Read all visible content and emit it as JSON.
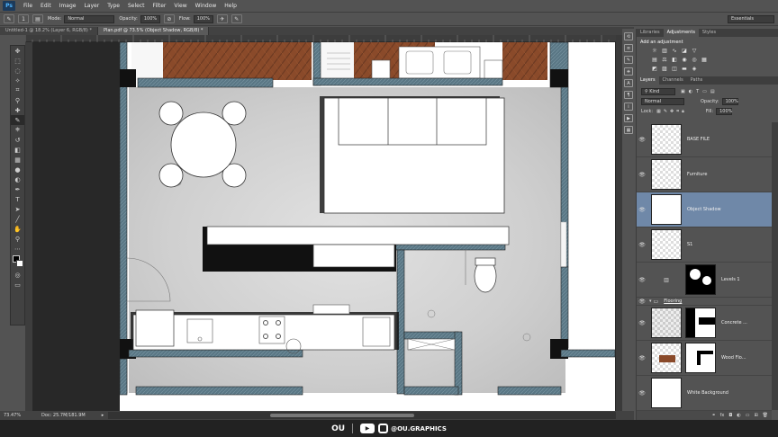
{
  "menubar": {
    "logo": "Ps",
    "items": [
      "File",
      "Edit",
      "Image",
      "Layer",
      "Type",
      "Select",
      "Filter",
      "View",
      "Window",
      "Help"
    ]
  },
  "options": {
    "mode_label": "Mode:",
    "mode_value": "Normal",
    "opacity_label": "Opacity:",
    "opacity_value": "100%",
    "flow_label": "Flow:",
    "flow_value": "100%",
    "brush_size": "1",
    "workspace": "Essentials"
  },
  "tabs": [
    {
      "label": "Untitled-1 @ 18.2% (Layer 6, RGB/8) *",
      "active": false
    },
    {
      "label": "Plan.pdf @ 73.5% (Object Shadow, RGB/8) *",
      "active": true
    }
  ],
  "status": {
    "zoom": "73.47%",
    "doc": "Doc: 25.7M/181.9M"
  },
  "panels": {
    "top_tabs": [
      "Libraries",
      "Adjustments",
      "Styles"
    ],
    "top_active": "Adjustments",
    "adjustments_title": "Add an adjustment",
    "layers_tabs": [
      "Layers",
      "Channels",
      "Paths"
    ],
    "layers_active": "Layers",
    "kind": "Kind",
    "blend_mode": "Normal",
    "opacity_label": "Opacity:",
    "opacity_value": "100%",
    "lock_label": "Lock:",
    "fill_label": "Fill:",
    "fill_value": "100%",
    "layers": [
      {
        "name": "BASE FILE",
        "type": "plain",
        "selected": false
      },
      {
        "name": "Furniture",
        "type": "plain",
        "selected": false
      },
      {
        "name": "Object Shadow",
        "type": "plain",
        "selected": true
      },
      {
        "name": "S1",
        "type": "plain",
        "selected": false
      },
      {
        "name": "Levels 1",
        "type": "adjust",
        "selected": false
      },
      {
        "name": "Flooring",
        "type": "group",
        "selected": false
      },
      {
        "name": "Concrete ...",
        "type": "masked",
        "selected": false
      },
      {
        "name": "Wood Flo...",
        "type": "masked",
        "selected": false
      },
      {
        "name": "White Background",
        "type": "plain",
        "selected": false
      }
    ]
  },
  "watermark": {
    "logo": "OU",
    "handle": "@OU.GRAPHICS"
  },
  "colors": {
    "wall": "#5a7785",
    "wood": "#8a4a2a",
    "concrete": "#cfcfcf",
    "selected_layer": "#6f88a8"
  }
}
